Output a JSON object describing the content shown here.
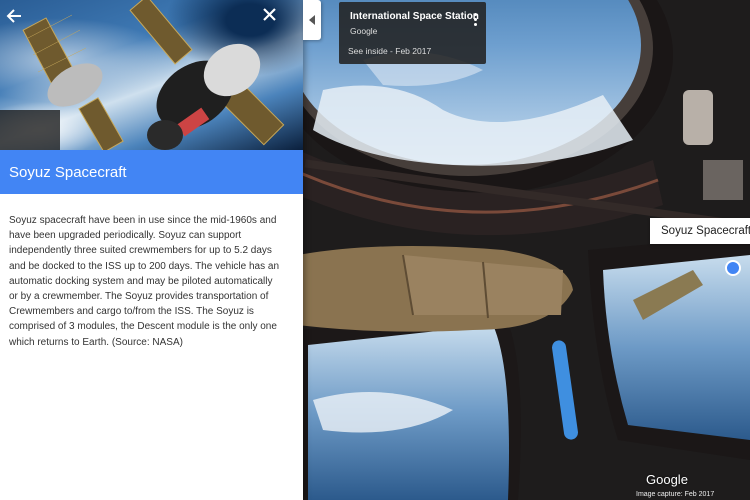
{
  "panel": {
    "back_icon": "arrow-back-icon",
    "close_icon": "close-icon",
    "title": "Soyuz Spacecraft",
    "description": "Soyuz spacecraft have been in use since the mid-1960s and have been upgraded periodically. Soyuz can support independently three suited crewmembers for up to 5.2 days and be docked to the ISS up to 200 days. The vehicle has an automatic docking system and may be piloted automatically or by a crewmember. The Soyuz provides transportation of Crewmembers and cargo to/from the ISS. The Soyuz is comprised of 3 modules, the Descent module is the only one which returns to Earth. (Source: NASA)",
    "header_color": "#4285f4"
  },
  "location_card": {
    "title": "International Space Station",
    "subtitle": "Google",
    "link": "See inside - Feb 2017",
    "more_icon": "more-vert-icon"
  },
  "collapse_icon": "triangle-left-icon",
  "label_chip": {
    "text": "Soyuz Spacecraft"
  },
  "branding": {
    "logo": "Google",
    "footer": "Image capture: Feb 2017"
  }
}
